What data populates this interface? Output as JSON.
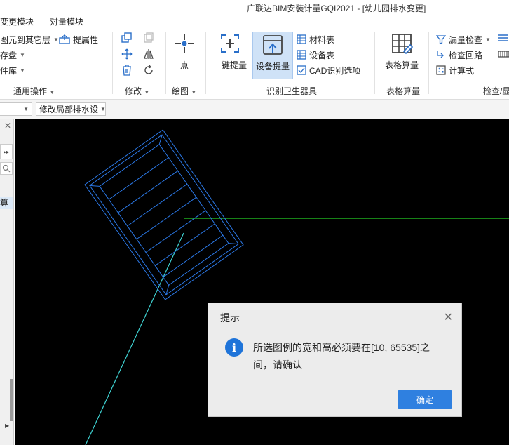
{
  "window": {
    "title": "广联达BIM安装计量GQI2021 - [幼儿园排水变更]"
  },
  "menu": {
    "items": [
      "变更模块",
      "对量模块"
    ]
  },
  "ribbon": {
    "general": {
      "items": [
        "图元到其它层",
        "存盘",
        "件库"
      ],
      "prop_button": "提属性",
      "group_label": "通用操作"
    },
    "modify": {
      "group_label": "修改"
    },
    "draw": {
      "point_label": "点",
      "group_label": "绘图"
    },
    "identify": {
      "one_key": "一键提量",
      "equipment": "设备提量",
      "material_table": "材料表",
      "equipment_table": "设备表",
      "cad_options": "CAD识别选项",
      "group_label": "识别卫生器具"
    },
    "table_calc": {
      "button": "表格算量",
      "group_label": "表格算量"
    },
    "check": {
      "leak_check": "漏量检查",
      "loop_check": "检查回路",
      "formula": "计算式",
      "group_label": "检查/显"
    }
  },
  "toolbar2": {
    "combo2": "修改局部排水设"
  },
  "leftpanel": {
    "label": "算"
  },
  "dialog": {
    "title": "提示",
    "message": "所选图例的宽和高必须要在[10, 65535]之间，请确认",
    "ok": "确定"
  }
}
